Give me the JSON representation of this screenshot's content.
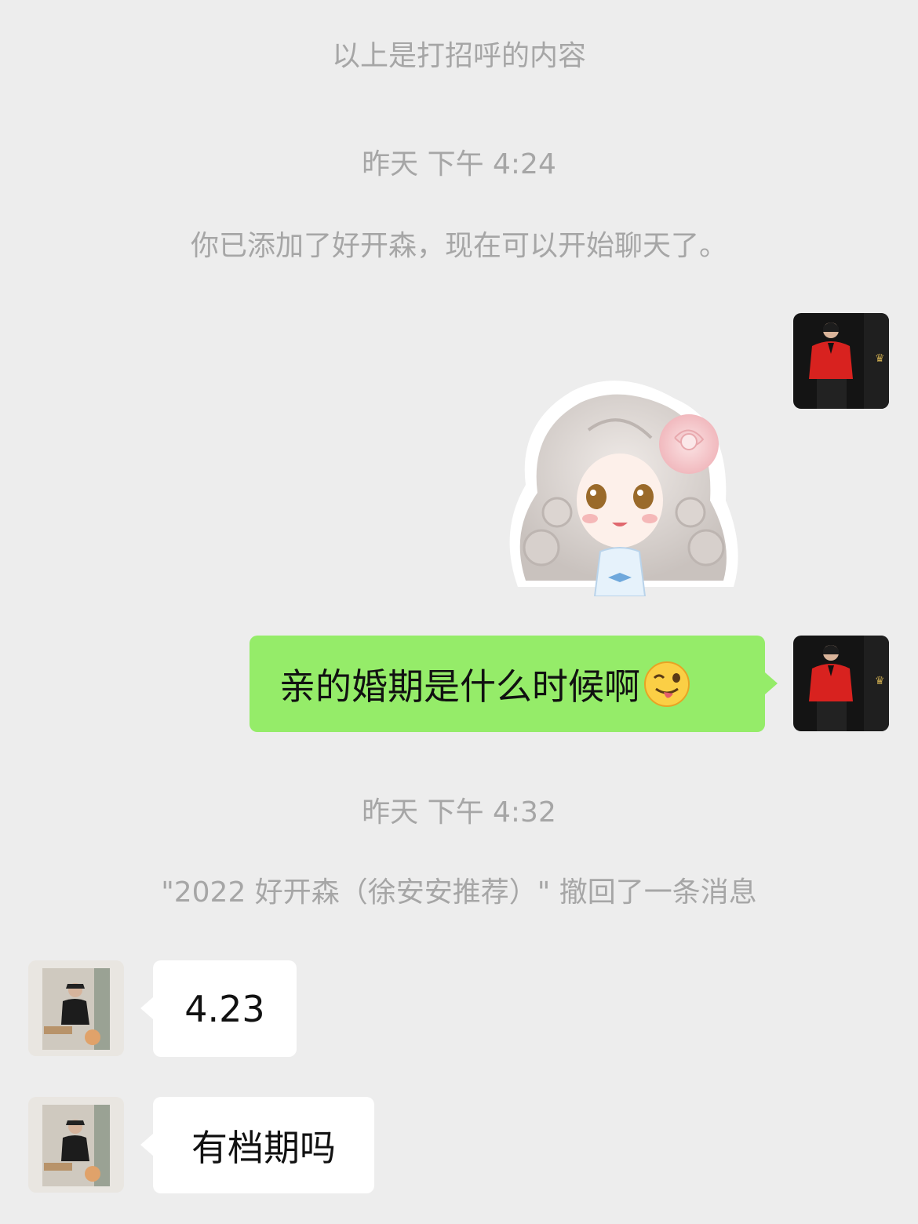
{
  "system": {
    "greeting_note": "以上是打招呼的内容",
    "time_1": "昨天 下午 4:24",
    "added_note": "你已添加了好开森，现在可以开始聊天了。",
    "time_2": "昨天 下午 4:32",
    "recall_note": "\"2022 好开森（徐安安推荐）\" 撤回了一条消息"
  },
  "messages": [
    {
      "from": "me",
      "type": "sticker",
      "sticker": "cartoon-girl-sticker"
    },
    {
      "from": "me",
      "type": "text",
      "text": "亲的婚期是什么时候啊",
      "emoji": "😜"
    },
    {
      "from": "other",
      "type": "text",
      "text": "4.23"
    },
    {
      "from": "other",
      "type": "text",
      "text": "有档期吗"
    }
  ],
  "colors": {
    "background": "#ededed",
    "my_bubble": "#95ec69",
    "other_bubble": "#ffffff",
    "system_text": "#a6a6a6"
  }
}
